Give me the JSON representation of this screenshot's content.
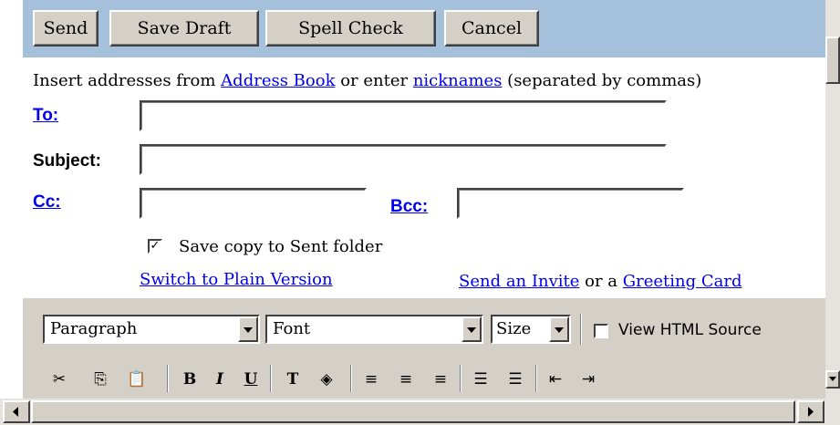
{
  "toolbar": {
    "send_label": "Send",
    "save_draft_label": "Save Draft",
    "spell_check_label": "Spell Check",
    "cancel_label": "Cancel"
  },
  "address_hint": {
    "prefix": "Insert addresses from ",
    "address_book_link": "Address Book",
    "middle": " or enter ",
    "nicknames_link": "nicknames",
    "suffix": " (separated by commas)"
  },
  "fields": {
    "to_label": "To:",
    "to_value": "",
    "subject_label": "Subject:",
    "subject_value": "",
    "cc_label": "Cc:",
    "cc_value": "",
    "bcc_label": "Bcc:",
    "bcc_value": ""
  },
  "save_copy": {
    "label": "Save copy to Sent folder",
    "checked": true
  },
  "links": {
    "switch_plain": "Switch to Plain Version",
    "send_invite": "Send an Invite",
    "or_a": "or a",
    "greeting_card": "Greeting Card"
  },
  "editor": {
    "paragraph_select": "Paragraph",
    "font_select": "Font",
    "size_select": "Size",
    "view_html_label": "View HTML Source",
    "view_html_checked": false
  },
  "colors": {
    "toolbar_bg": "#a4c0da",
    "link": "#0000ee",
    "panel_bg": "#d4d0c8"
  },
  "icons": [
    "cut-icon",
    "copy-icon",
    "paste-icon",
    "bold-icon",
    "italic-icon",
    "underline-icon",
    "text-color-icon",
    "highlight-color-icon",
    "align-left-icon",
    "align-center-icon",
    "align-right-icon",
    "numbered-list-icon",
    "bulleted-list-icon",
    "outdent-icon",
    "indent-icon"
  ]
}
